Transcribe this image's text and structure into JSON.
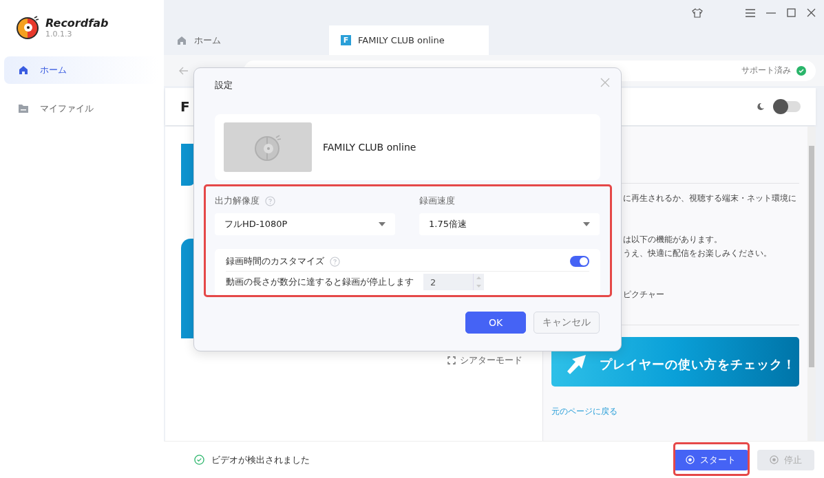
{
  "app": {
    "name": "Recordfab",
    "version": "1.0.1.3"
  },
  "sidebar": {
    "items": [
      {
        "label": "ホーム",
        "selected": true,
        "kind": "home"
      },
      {
        "label": "マイファイル",
        "selected": false,
        "kind": "folder"
      }
    ]
  },
  "tabs": [
    {
      "label": "ホーム",
      "selected": false,
      "kind": "home"
    },
    {
      "label": "FAMILY CLUB online",
      "selected": true,
      "kind": "site",
      "icon_text": "F"
    }
  ],
  "address_bar": {
    "status": "サポート済み"
  },
  "page": {
    "heading": "F",
    "dark_mode": false,
    "side_panel": {
      "lines": [
        {
          "text": "に再生されるか、視聴する端末・ネット環境に",
          "kind": "gap"
        },
        {
          "text": "は以下の機能があります。",
          "kind": "tight"
        },
        {
          "text": "うえ、快適に配信をお楽しみください。",
          "kind": "gap"
        },
        {
          "text": "ピクチャー",
          "kind": "gap"
        }
      ],
      "banner": "プレイヤーの使い方をチェック！",
      "link": "元のページに戻る"
    },
    "theater_mode": "シアターモード"
  },
  "status_bar": {
    "message": "ビデオが検出されました",
    "buttons": [
      {
        "label": "スタート",
        "disabled": false,
        "highlighted": true
      },
      {
        "label": "停止",
        "disabled": true,
        "highlighted": false
      }
    ]
  },
  "dialog": {
    "title": "設定",
    "video_title": "FAMILY CLUB online",
    "highlighted": true,
    "resolution": {
      "label": "出力解像度",
      "value": "フルHD-1080P"
    },
    "speed": {
      "label": "録画速度",
      "value": "1.75倍速"
    },
    "custom_time": {
      "label": "録画時間のカスタマイズ",
      "on": true,
      "description": "動画の長さが数分に達すると録画が停止します",
      "value": "2"
    },
    "buttons": [
      {
        "label": "OK",
        "kind": "primary"
      },
      {
        "label": "キャンセル",
        "kind": "secondary"
      }
    ]
  }
}
